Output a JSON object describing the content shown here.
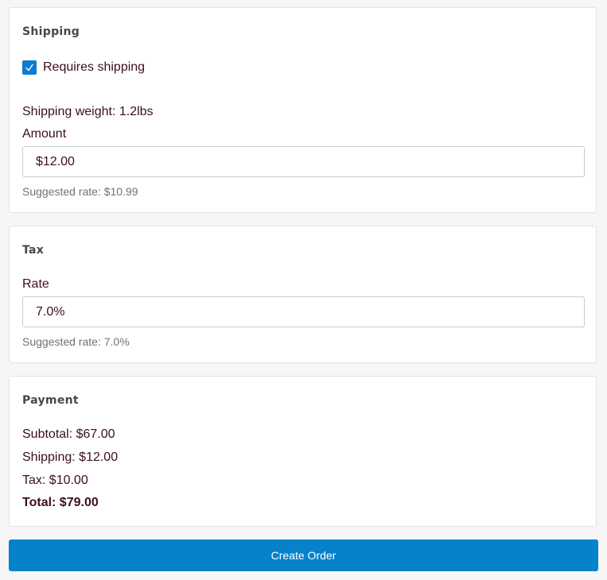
{
  "shipping": {
    "title": "Shipping",
    "requires_shipping_label": "Requires shipping",
    "requires_shipping_checked": true,
    "weight_text": "Shipping weight: 1.2lbs",
    "amount_label": "Amount",
    "amount_value": "$12.00",
    "suggested_rate_text": "Suggested rate: $10.99"
  },
  "tax": {
    "title": "Tax",
    "rate_label": "Rate",
    "rate_value": "7.0%",
    "suggested_rate_text": "Suggested rate: 7.0%"
  },
  "payment": {
    "title": "Payment",
    "subtotal_text": "Subtotal: $67.00",
    "shipping_text": "Shipping: $12.00",
    "tax_text": "Tax: $10.00",
    "total_text": "Total: $79.00"
  },
  "actions": {
    "create_order_label": "Create Order"
  },
  "colors": {
    "accent": "#0582ca",
    "text": "#3c0f1a",
    "background": "#f6f6f7"
  },
  "icons": {
    "checkbox": "checkmark-icon"
  }
}
